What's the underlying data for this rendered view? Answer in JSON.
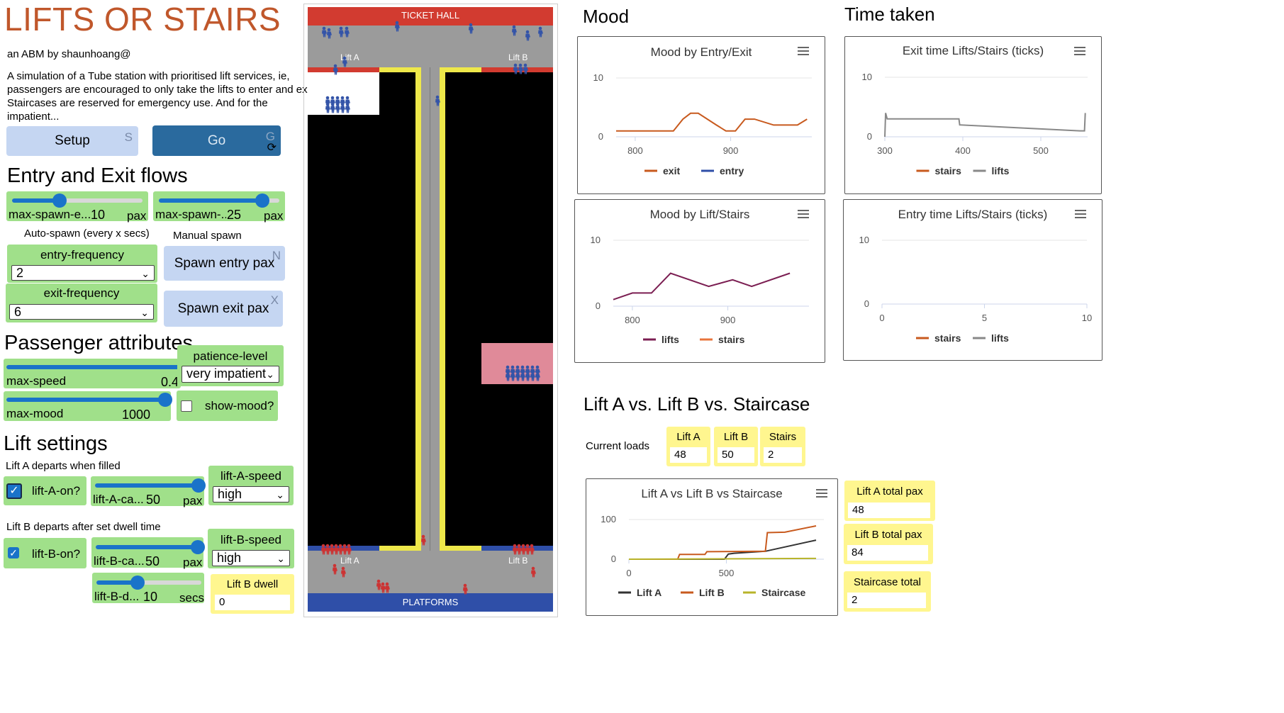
{
  "app": {
    "title": "LIFTS OR STAIRS",
    "author": "an ABM by shaunhoang@",
    "description": "A simulation of a Tube station with prioritised lift services, ie, passengers are encouraged to only take the lifts to enter and exit. Staircases are reserved for emergency use. And for the impatient..."
  },
  "buttons": {
    "setup": {
      "label": "Setup",
      "key": "S"
    },
    "go": {
      "label": "Go",
      "key": "G"
    },
    "spawn_entry": {
      "label": "Spawn entry pax",
      "key": "N"
    },
    "spawn_exit": {
      "label": "Spawn exit pax",
      "key": "X"
    }
  },
  "flows": {
    "heading": "Entry and Exit flows",
    "max_spawn_entry": {
      "label": "max-spawn-e...",
      "value": "10",
      "unit": "pax",
      "fraction": 0.33
    },
    "max_spawn_exit": {
      "label": "max-spawn-...",
      "value": "25",
      "unit": "pax",
      "fraction": 0.9
    },
    "auto_spawn_label": "Auto-spawn (every x secs)",
    "manual_spawn_label": "Manual spawn",
    "entry_frequency": {
      "label": "entry-frequency",
      "value": "2"
    },
    "exit_frequency": {
      "label": "exit-frequency",
      "value": "6"
    }
  },
  "passenger": {
    "heading": "Passenger attributes",
    "max_speed": {
      "label": "max-speed",
      "value": "0.4",
      "fraction": 1.0
    },
    "max_mood": {
      "label": "max-mood",
      "value": "1000",
      "fraction": 1.0
    },
    "patience_level": {
      "label": "patience-level",
      "value": "very impatient"
    },
    "show_mood": {
      "label": "show-mood?",
      "checked": false
    }
  },
  "lift_settings": {
    "heading": "Lift settings",
    "lift_a_note": "Lift A departs when filled",
    "lift_b_note": "Lift B departs after set dwell time",
    "lift_a_on": {
      "label": "lift-A-on?",
      "checked": true
    },
    "lift_b_on": {
      "label": "lift-B-on?",
      "checked": true
    },
    "lift_a_capacity": {
      "label": "lift-A-ca...",
      "value": "50",
      "unit": "pax",
      "fraction": 1.0
    },
    "lift_b_capacity": {
      "label": "lift-B-ca...",
      "value": "50",
      "unit": "pax",
      "fraction": 1.0
    },
    "lift_b_dwell_slider": {
      "label": "lift-B-d...",
      "value": "10",
      "unit": "secs",
      "fraction": 0.45
    },
    "lift_a_speed": {
      "label": "lift-A-speed",
      "value": "high"
    },
    "lift_b_speed": {
      "label": "lift-B-speed",
      "value": "high"
    },
    "lift_b_dwell_monitor": {
      "label": "Lift B dwell",
      "value": "0"
    }
  },
  "world": {
    "ticket_hall": "TICKET HALL",
    "platforms": "PLATFORMS",
    "lift_a_top": "Lift A",
    "lift_b_top": "Lift B",
    "lift_a_bottom": "Lift A",
    "lift_b_bottom": "Lift B"
  },
  "mood_section": {
    "heading": "Mood",
    "chart1": {
      "title": "Mood by Entry/Exit"
    },
    "chart2": {
      "title": "Mood by Lift/Stairs"
    }
  },
  "time_section": {
    "heading": "Time taken",
    "chart3": {
      "title": "Exit time Lifts/Stairs (ticks)"
    },
    "chart4": {
      "title": "Entry time Lifts/Stairs (ticks)"
    }
  },
  "comparison": {
    "heading": "Lift A vs. Lift B vs. Staircase",
    "current_loads_label": "Current loads",
    "loads": [
      {
        "label": "Lift A",
        "value": "48"
      },
      {
        "label": "Lift B",
        "value": "50"
      },
      {
        "label": "Stairs",
        "value": "2"
      }
    ],
    "chart5": {
      "title": "Lift A vs Lift B vs Staircase"
    },
    "totals": [
      {
        "label": "Lift A total pax",
        "value": "48"
      },
      {
        "label": "Lift B total pax",
        "value": "84"
      },
      {
        "label": "Staircase total",
        "value": "2"
      }
    ]
  },
  "colors": {
    "orange": "#c85a1e",
    "blue": "#2f4fa8",
    "purple": "#7b1e52",
    "gray": "#888888",
    "dark": "#333333",
    "olive": "#b8b42a"
  },
  "chart_data": [
    {
      "type": "line",
      "title": "Mood by Entry/Exit",
      "xlim": [
        780,
        985
      ],
      "ylim": [
        0,
        10
      ],
      "xticks": [
        "800",
        "900"
      ],
      "yticks": [
        "0",
        "10"
      ],
      "series": [
        {
          "name": "exit",
          "color": "#c85a1e",
          "points": [
            [
              780,
              1
            ],
            [
              840,
              1
            ],
            [
              850,
              3
            ],
            [
              858,
              4
            ],
            [
              866,
              4
            ],
            [
              885,
              2
            ],
            [
              895,
              1
            ],
            [
              905,
              1
            ],
            [
              915,
              3
            ],
            [
              925,
              3
            ],
            [
              945,
              2
            ],
            [
              970,
              2
            ],
            [
              980,
              3
            ]
          ]
        },
        {
          "name": "entry",
          "color": "#2f4fa8",
          "points": []
        }
      ]
    },
    {
      "type": "line",
      "title": "Mood by Lift/Stairs",
      "xlim": [
        780,
        985
      ],
      "ylim": [
        0,
        10
      ],
      "xticks": [
        "800",
        "900"
      ],
      "yticks": [
        "0",
        "10"
      ],
      "series": [
        {
          "name": "lifts",
          "color": "#7b1e52",
          "points": [
            [
              780,
              1
            ],
            [
              800,
              2
            ],
            [
              820,
              2
            ],
            [
              840,
              5
            ],
            [
              880,
              3
            ],
            [
              905,
              4
            ],
            [
              925,
              3
            ],
            [
              965,
              5
            ]
          ]
        },
        {
          "name": "stairs",
          "color": "#e8743b",
          "points": []
        }
      ]
    },
    {
      "type": "line",
      "title": "Exit time Lifts/Stairs (ticks)",
      "xlim": [
        300,
        560
      ],
      "ylim": [
        0,
        10
      ],
      "xticks": [
        "300",
        "400",
        "500"
      ],
      "yticks": [
        "0",
        "10"
      ],
      "series": [
        {
          "name": "stairs",
          "color": "#c85a1e",
          "points": []
        },
        {
          "name": "lifts",
          "color": "#888888",
          "points": [
            [
              300,
              0
            ],
            [
              301,
              4
            ],
            [
              303,
              3
            ],
            [
              395,
              3
            ],
            [
              396,
              2
            ],
            [
              550,
              1
            ],
            [
              556,
              1
            ],
            [
              557,
              4
            ]
          ]
        }
      ]
    },
    {
      "type": "line",
      "title": "Entry time Lifts/Stairs (ticks)",
      "xlim": [
        0,
        10
      ],
      "ylim": [
        0,
        10
      ],
      "xticks": [
        "0",
        "5",
        "10"
      ],
      "yticks": [
        "0",
        "10"
      ],
      "series": [
        {
          "name": "stairs",
          "color": "#c85a1e",
          "points": []
        },
        {
          "name": "lifts",
          "color": "#888888",
          "points": []
        }
      ]
    },
    {
      "type": "line",
      "title": "Lift A vs Lift B vs Staircase",
      "xlim": [
        0,
        1000
      ],
      "ylim": [
        0,
        100
      ],
      "xticks": [
        "0",
        "500"
      ],
      "yticks": [
        "0",
        "100"
      ],
      "series": [
        {
          "name": "Lift A",
          "color": "#333333",
          "points": [
            [
              0,
              0
            ],
            [
              490,
              0
            ],
            [
              510,
              13
            ],
            [
              540,
              15
            ],
            [
              700,
              20
            ],
            [
              960,
              48
            ]
          ]
        },
        {
          "name": "Lift B",
          "color": "#c85a1e",
          "points": [
            [
              0,
              0
            ],
            [
              250,
              0
            ],
            [
              260,
              12
            ],
            [
              390,
              12
            ],
            [
              400,
              19
            ],
            [
              700,
              20
            ],
            [
              710,
              67
            ],
            [
              800,
              68
            ],
            [
              960,
              84
            ]
          ]
        },
        {
          "name": "Staircase",
          "color": "#b8b42a",
          "points": [
            [
              0,
              0
            ],
            [
              960,
              2
            ]
          ]
        }
      ]
    }
  ]
}
